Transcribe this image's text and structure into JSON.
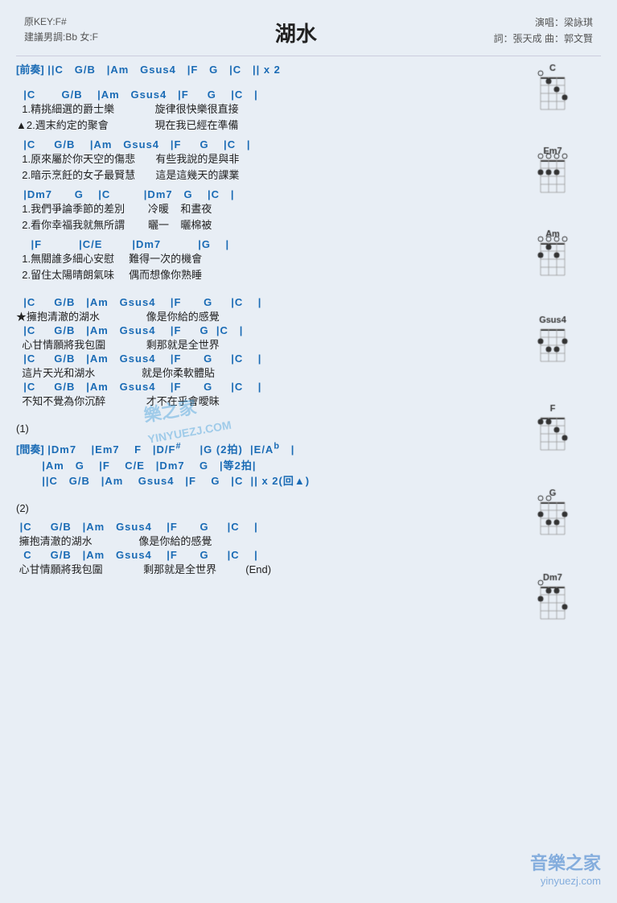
{
  "header": {
    "key_info_line1": "原KEY:F#",
    "key_info_line2": "建議男調:Bb 女:F",
    "title": "湖水",
    "artist_line1": "演唱：梁詠琪",
    "artist_line2": "詞：張天成  曲：郭文賢"
  },
  "sections": [
    {
      "id": "intro",
      "label": "[前奏]",
      "lines": [
        {
          "type": "chord",
          "text": "||C   G/B   |Am   Gsus4   |F   G   |C   || x 2"
        }
      ]
    },
    {
      "id": "verse1a",
      "lines": [
        {
          "type": "chord",
          "text": "  |C       G/B    |Am   Gsus4   |F     G    |C   |"
        },
        {
          "type": "lyric",
          "text": "  1.精挑細選的爵士樂              旋律很快樂很直接"
        },
        {
          "type": "lyric",
          "text": "▲2.週末約定的聚會                現在我已經在準備"
        }
      ]
    },
    {
      "id": "verse1b",
      "lines": [
        {
          "type": "chord",
          "text": "  |C     G/B    |Am   Gsus4   |F     G    |C   |"
        },
        {
          "type": "lyric",
          "text": "  1.原來屬於你天空的傷悲       有些我說的是與非"
        },
        {
          "type": "lyric",
          "text": "  2.暗示烹飪的女子最賢慧       這是這幾天的課業"
        }
      ]
    },
    {
      "id": "verse1c",
      "lines": [
        {
          "type": "chord",
          "text": "  |Dm7      G    |C         |Dm7   G    |C   |"
        },
        {
          "type": "lyric",
          "text": "  1.我們爭論季節的差別        冷暖    和晝夜"
        },
        {
          "type": "lyric",
          "text": "  2.看你幸福我就無所謂        曬一    曬棉被"
        }
      ]
    },
    {
      "id": "verse1d",
      "lines": [
        {
          "type": "chord",
          "text": "    |F          |C/E        |Dm7          |G    |"
        },
        {
          "type": "lyric",
          "text": "  1.無關誰多細心安慰     難得一次的機會"
        },
        {
          "type": "lyric",
          "text": "  2.留住太陽晴朗氣味     偶而想像你熟睡"
        }
      ]
    },
    {
      "id": "spacer1"
    },
    {
      "id": "chorus1",
      "lines": [
        {
          "type": "chord",
          "text": "  |C     G/B   |Am   Gsus4    |F      G     |C    |"
        },
        {
          "type": "lyric",
          "text": "★擁抱清澈的湖水                像是你給的感覺"
        },
        {
          "type": "chord",
          "text": "  |C     G/B   |Am   Gsus4    |F     G  |C   |"
        },
        {
          "type": "lyric",
          "text": "  心甘情願將我包圍              剩那就是全世界"
        },
        {
          "type": "chord",
          "text": "  |C     G/B   |Am   Gsus4    |F      G     |C    |"
        },
        {
          "type": "lyric",
          "text": "  這片天光和湖水                就是你柔軟體貼"
        },
        {
          "type": "chord",
          "text": "  |C     G/B   |Am   Gsus4    |F      G     |C    |"
        },
        {
          "type": "lyric",
          "text": "  不知不覺為你沉醉              才不在乎會曖昧"
        }
      ]
    },
    {
      "id": "spacer2"
    },
    {
      "id": "note1",
      "lines": [
        {
          "type": "lyric",
          "text": "(1)"
        }
      ]
    },
    {
      "id": "interlude",
      "label": "[間奏]",
      "lines": [
        {
          "type": "chord",
          "text": " |Dm7    |Em7    F   |D/F#     |G (2拍)  |E/Ab   |"
        },
        {
          "type": "chord",
          "text": "       |Am   G    |F    C/E   |Dm7    G   |等2拍|"
        },
        {
          "type": "chord",
          "text": "       ||C   G/B   |Am    Gsus4   |F    G   |C  || x 2(回▲)"
        }
      ]
    },
    {
      "id": "spacer3"
    },
    {
      "id": "note2",
      "lines": [
        {
          "type": "lyric",
          "text": "(2)"
        }
      ]
    },
    {
      "id": "chorus2",
      "lines": [
        {
          "type": "chord",
          "text": " |C     G/B   |Am   Gsus4    |F      G     |C    |"
        },
        {
          "type": "lyric",
          "text": " 擁抱清澈的湖水                像是你給的感覺"
        },
        {
          "type": "chord",
          "text": "  C     G/B   |Am   Gsus4    |F      G     |C    |"
        },
        {
          "type": "lyric",
          "text": " 心甘情願將我包圍              剩那就是全世界          (End)"
        }
      ]
    }
  ],
  "chord_diagrams": [
    {
      "name": "C",
      "fret_offset": 0,
      "dots": [
        [
          1,
          1
        ],
        [
          2,
          4
        ],
        [
          3,
          3
        ],
        [
          4,
          2
        ]
      ],
      "open": [
        0,
        0,
        0
      ],
      "mute": []
    },
    {
      "name": "Em7",
      "fret_offset": 0,
      "dots": [
        [
          2,
          2
        ],
        [
          3,
          2
        ]
      ],
      "open": [
        0,
        0,
        0,
        0
      ],
      "mute": []
    },
    {
      "name": "Am",
      "fret_offset": 0,
      "dots": [
        [
          1,
          2
        ],
        [
          2,
          1
        ]
      ],
      "open": [
        0,
        0,
        0
      ],
      "mute": []
    },
    {
      "name": "Gsus4",
      "fret_offset": 0,
      "dots": [
        [
          1,
          3
        ],
        [
          2,
          2
        ],
        [
          3,
          3
        ]
      ],
      "open": [
        0,
        0
      ],
      "mute": []
    },
    {
      "name": "F",
      "fret_offset": 0,
      "dots": [
        [
          1,
          1
        ],
        [
          2,
          2
        ],
        [
          3,
          3
        ],
        [
          4,
          3
        ]
      ],
      "open": [],
      "mute": []
    },
    {
      "name": "G",
      "fret_offset": 0,
      "dots": [
        [
          1,
          2
        ],
        [
          2,
          3
        ],
        [
          3,
          4
        ]
      ],
      "open": [
        0,
        0
      ],
      "mute": []
    },
    {
      "name": "Dm7",
      "fret_offset": 0,
      "dots": [
        [
          1,
          2
        ],
        [
          2,
          1
        ],
        [
          3,
          2
        ]
      ],
      "open": [
        0
      ],
      "mute": []
    }
  ],
  "watermark": {
    "text1": "樂之家",
    "text2": "YINYUEZJ.COM",
    "footer1": "音樂之家",
    "footer2": "yinyuezj.com"
  }
}
